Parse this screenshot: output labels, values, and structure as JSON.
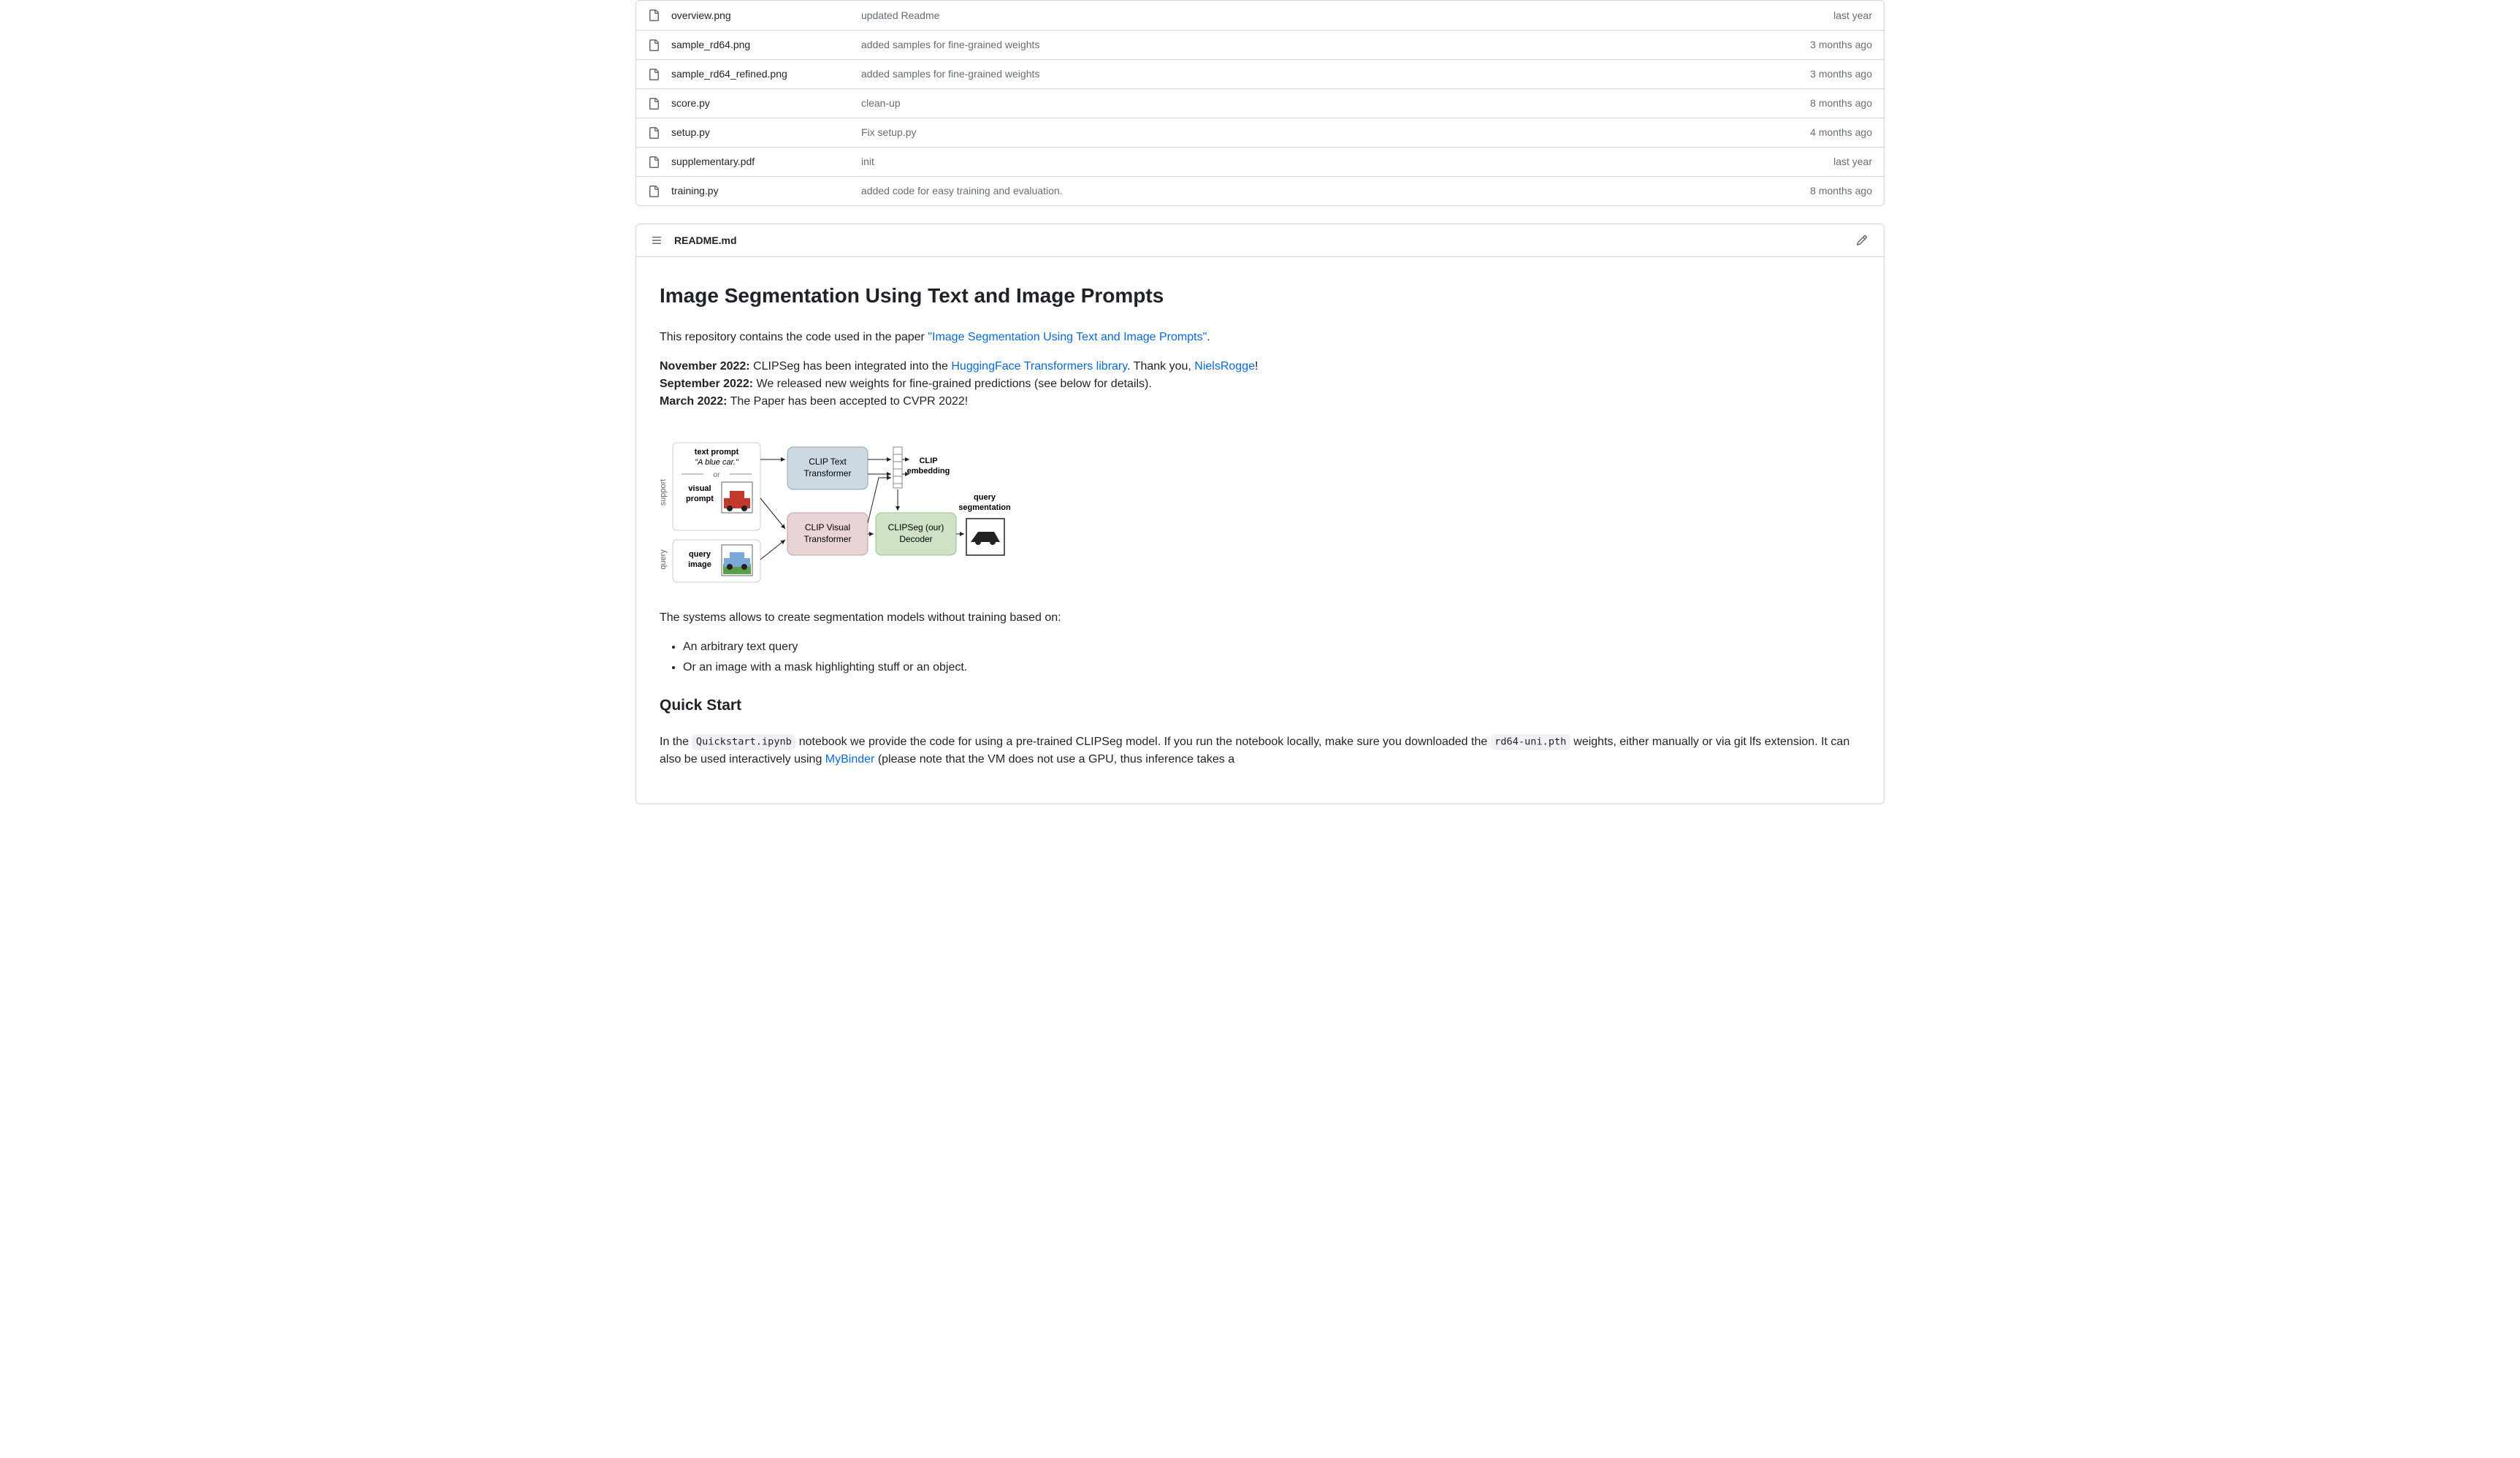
{
  "files": [
    {
      "name": "overview.png",
      "commit": "updated Readme",
      "time": "last year"
    },
    {
      "name": "sample_rd64.png",
      "commit": "added samples for fine-grained weights",
      "time": "3 months ago"
    },
    {
      "name": "sample_rd64_refined.png",
      "commit": "added samples for fine-grained weights",
      "time": "3 months ago"
    },
    {
      "name": "score.py",
      "commit": "clean-up",
      "time": "8 months ago"
    },
    {
      "name": "setup.py",
      "commit": "Fix setup.py",
      "time": "4 months ago"
    },
    {
      "name": "supplementary.pdf",
      "commit": "init",
      "time": "last year"
    },
    {
      "name": "training.py",
      "commit": "added code for easy training and evaluation.",
      "time": "8 months ago"
    }
  ],
  "readme": {
    "filename": "README.md",
    "h1": "Image Segmentation Using Text and Image Prompts",
    "intro_before": "This repository contains the code used in the paper ",
    "intro_link": "\"Image Segmentation Using Text and Image Prompts\"",
    "intro_after": ".",
    "news": {
      "nov_bold": "November 2022:",
      "nov_before": " CLIPSeg has been integrated into the ",
      "nov_link1": "HuggingFace Transformers library",
      "nov_mid": ". Thank you, ",
      "nov_link2": "NielsRogge",
      "nov_after": "!",
      "sep_bold": "September 2022:",
      "sep_text": " We released new weights for fine-grained predictions (see below for details).",
      "mar_bold": "March 2022:",
      "mar_text": " The Paper has been accepted to CVPR 2022!"
    },
    "diagram": {
      "text_prompt_label": "text prompt",
      "text_prompt_example": "\"A blue car.\"",
      "or_label": "or",
      "visual_prompt_label": "visual prompt",
      "support_label": "support",
      "query_label": "query",
      "query_image_label": "query image",
      "clip_text": "CLIP Text Transformer",
      "clip_visual": "CLIP Visual Transformer",
      "clip_embedding": "CLIP embedding",
      "decoder": "CLIPSeg (our) Decoder",
      "query_seg_label": "query segmentation"
    },
    "desc": "The systems allows to create segmentation models without training based on:",
    "bullet1": "An arbitrary text query",
    "bullet2": "Or an image with a mask highlighting stuff or an object.",
    "quickstart_h2": "Quick Start",
    "qs_before1": "In the ",
    "qs_code1": "Quickstart.ipynb",
    "qs_mid1": " notebook we provide the code for using a pre-trained CLIPSeg model. If you run the notebook locally, make sure you downloaded the ",
    "qs_code2": "rd64-uni.pth",
    "qs_mid2": " weights, either manually or via git lfs extension. It can also be used interactively using ",
    "qs_link": "MyBinder",
    "qs_after": " (please note that the VM does not use a GPU, thus inference takes a"
  }
}
